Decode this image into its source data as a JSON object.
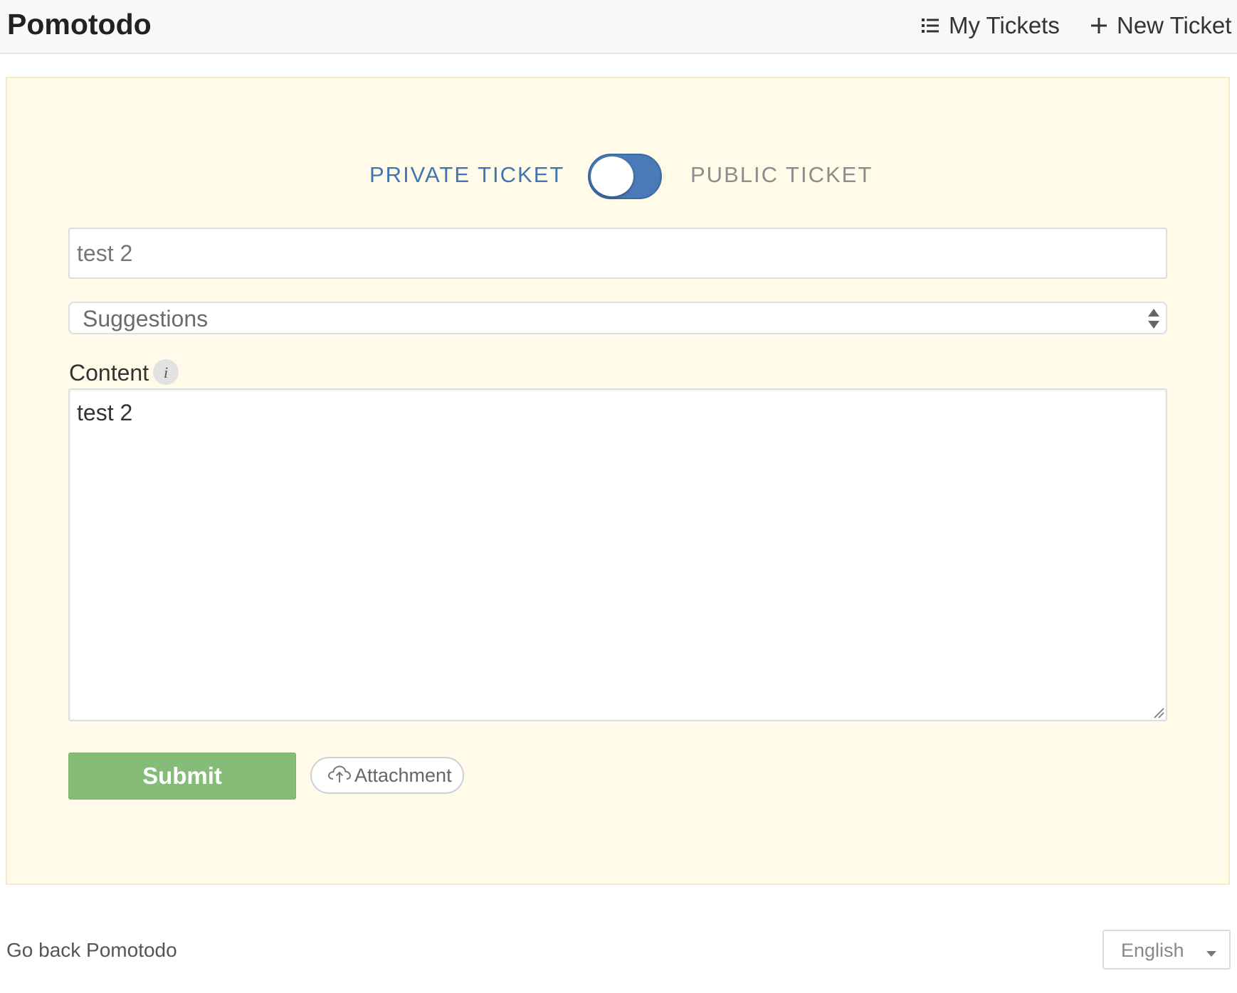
{
  "header": {
    "brand": "Pomotodo",
    "nav": {
      "my_tickets": "My Tickets",
      "new_ticket": "New Ticket"
    }
  },
  "form": {
    "visibility": {
      "private_label": "PRIVATE TICKET",
      "public_label": "PUBLIC TICKET",
      "selected": "private"
    },
    "title_value": "test 2",
    "category_selected": "Suggestions",
    "content_label": "Content",
    "content_info_icon": "i",
    "content_value": "test 2",
    "submit_label": "Submit",
    "attachment_label": "Attachment"
  },
  "footer": {
    "back_link": "Go back Pomotodo",
    "language_selected": "English"
  },
  "colors": {
    "accent_blue": "#4a7bb8",
    "submit_green": "#85bd78",
    "panel_bg": "#fffbe8"
  },
  "icons": {
    "my_tickets": "list-icon",
    "new_ticket": "plus-icon",
    "attachment": "cloud-upload-icon",
    "content_info": "info-icon"
  }
}
